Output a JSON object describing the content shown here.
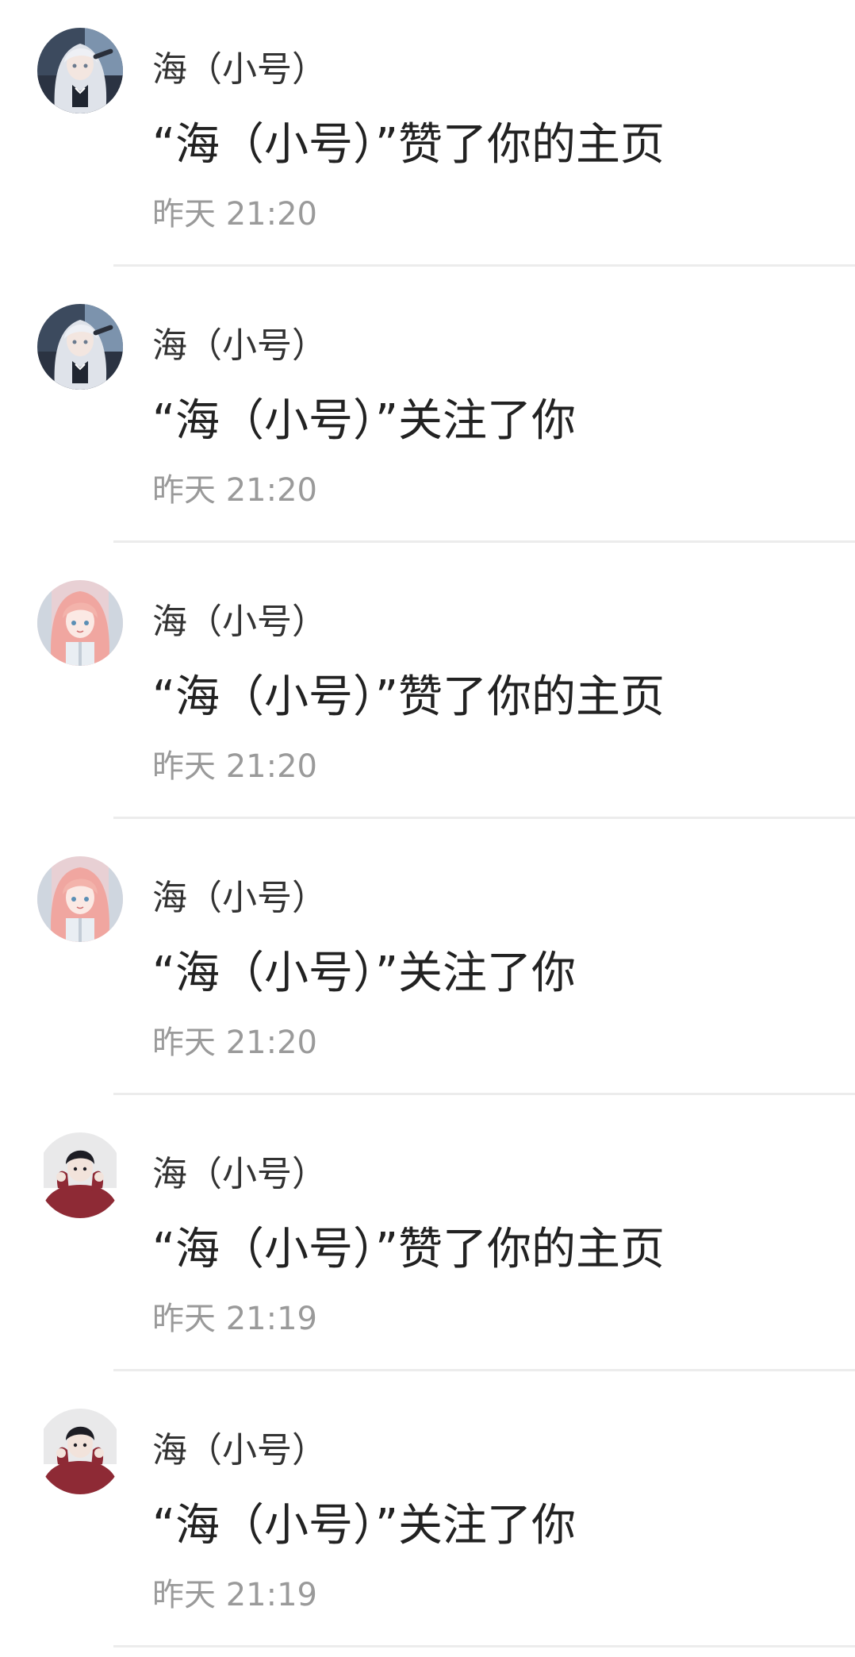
{
  "notifications": [
    {
      "avatar": "avatar-silver-hair-girl",
      "name": "海（小号）",
      "message": "“海（小号）”赞了你的主页",
      "time": "昨天 21:20"
    },
    {
      "avatar": "avatar-silver-hair-girl",
      "name": "海（小号）",
      "message": "“海（小号）”关注了你",
      "time": "昨天 21:20"
    },
    {
      "avatar": "avatar-pink-hair-girl",
      "name": "海（小号）",
      "message": "“海（小号）”赞了你的主页",
      "time": "昨天 21:20"
    },
    {
      "avatar": "avatar-pink-hair-girl",
      "name": "海（小号）",
      "message": "“海（小号）”关注了你",
      "time": "昨天 21:20"
    },
    {
      "avatar": "avatar-boy-red-sweater",
      "name": "海（小号）",
      "message": "“海（小号）”赞了你的主页",
      "time": "昨天 21:19"
    },
    {
      "avatar": "avatar-boy-red-sweater",
      "name": "海（小号）",
      "message": "“海（小号）”关注了你",
      "time": "昨天 21:19"
    }
  ]
}
